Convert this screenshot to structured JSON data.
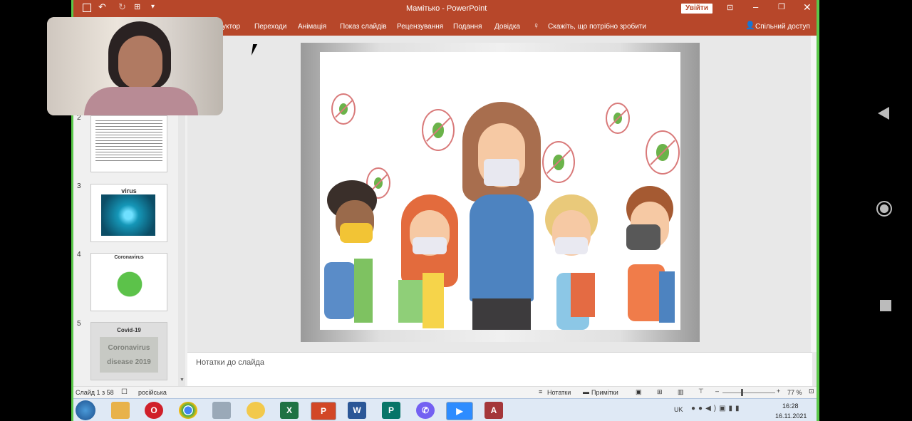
{
  "window": {
    "title": "Мамітько  -  PowerPoint",
    "signin_label": "Увійти"
  },
  "ribbon": {
    "tabs": [
      "уктор",
      "Переходи",
      "Анімація",
      "Показ слайдів",
      "Рецензування",
      "Подання",
      "Довідка"
    ],
    "tell_me": "Скажіть, що потрібно зробити",
    "share": "Спільний доступ"
  },
  "thumbnails": [
    {
      "num": "2",
      "title": ""
    },
    {
      "num": "3",
      "title": "virus"
    },
    {
      "num": "4",
      "title": "Coronavirus"
    },
    {
      "num": "5",
      "title": "Covid-19",
      "image_text": "Coronavirus disease 2019"
    }
  ],
  "notes": {
    "placeholder": "Нотатки до слайда"
  },
  "status": {
    "slide_info": "Слайд 1 з 58",
    "language": "російська",
    "notes_label": "Нотатки",
    "comments_label": "Примітки",
    "zoom": "77 %"
  },
  "taskbar": {
    "lang": "UK",
    "time": "16:28",
    "date": "16.11.2021",
    "apps": [
      "start",
      "folder",
      "opera",
      "chrome",
      "calculator",
      "paint",
      "excel",
      "powerpoint",
      "word",
      "publisher",
      "viber",
      "zoom",
      "access"
    ]
  },
  "colors": {
    "accent": "#b7472a",
    "taskbar": "#dfe9f5"
  }
}
